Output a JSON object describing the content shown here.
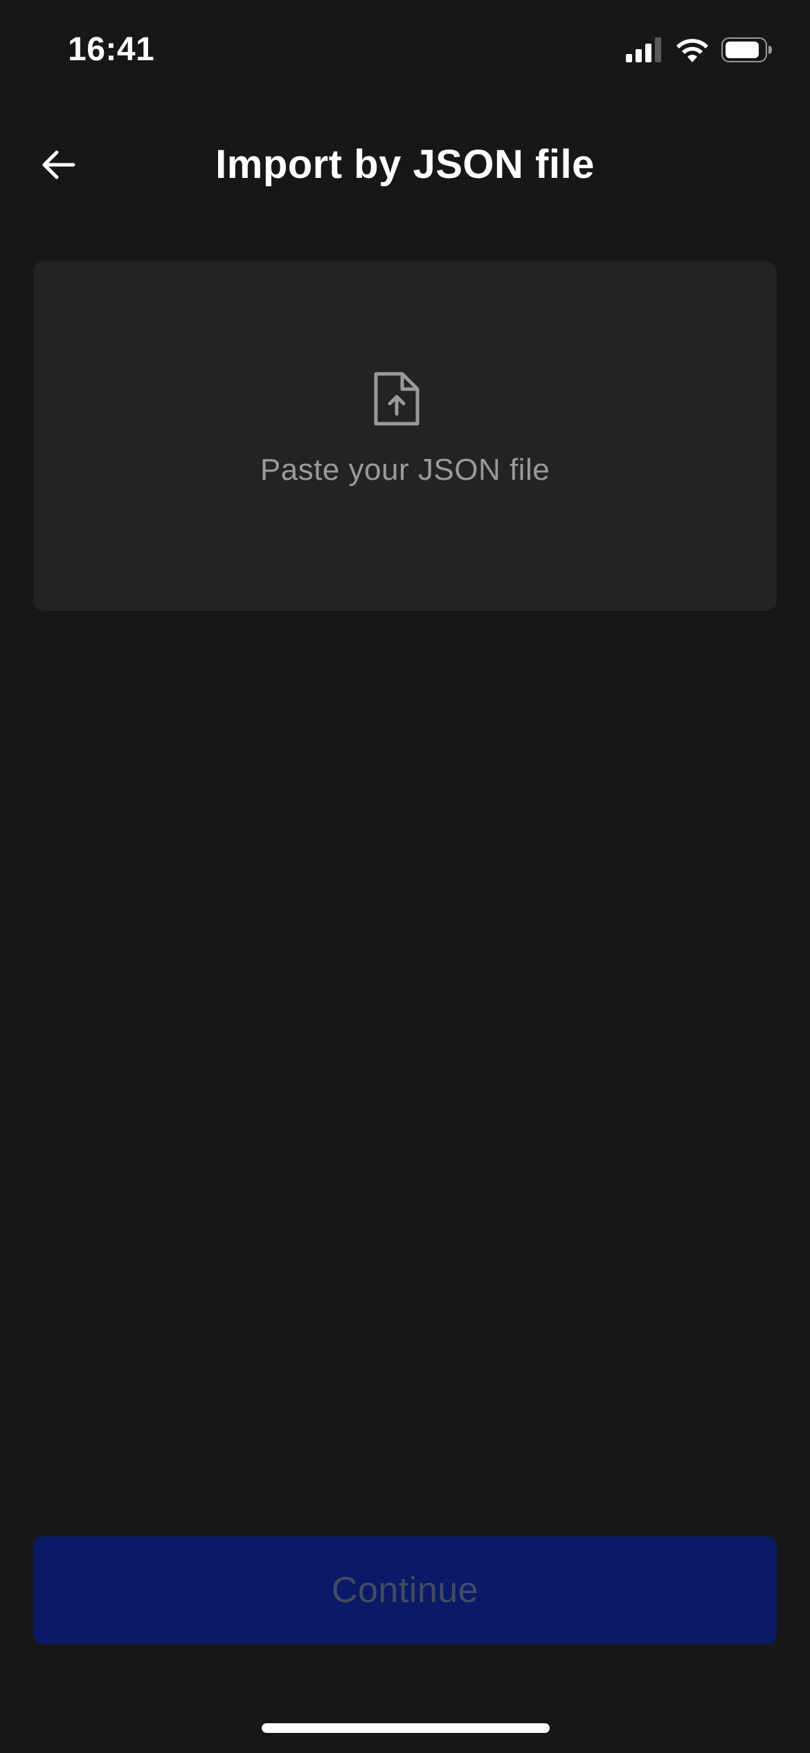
{
  "status_bar": {
    "time": "16:41",
    "icons": [
      "signal-icon",
      "wifi-icon",
      "battery-icon"
    ]
  },
  "header": {
    "back_icon": "arrow-left-icon",
    "title": "Import by JSON file"
  },
  "drop_zone": {
    "icon": "file-upload-icon",
    "label": "Paste your JSON file"
  },
  "footer": {
    "continue_label": "Continue"
  },
  "colors": {
    "background": "#171717",
    "card": "#232323",
    "button_disabled_bg": "#0a1a66",
    "button_disabled_text": "#444a63",
    "muted_text": "#9a9a9a"
  }
}
